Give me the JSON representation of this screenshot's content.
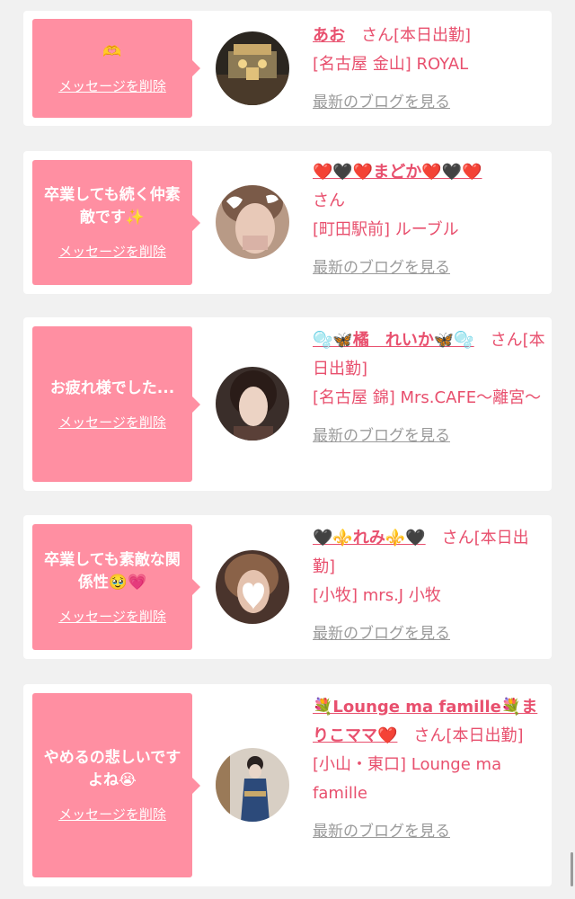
{
  "messages": [
    {
      "bubble_text": "🫶",
      "delete_label": "メッセージを削除",
      "name": "あお",
      "san_suffix": "さん[本日出勤]",
      "shop": "[名古屋 金山] ROYAL",
      "blog_label": "最新のブログを見る"
    },
    {
      "bubble_text": "卒業しても続く仲素敵です✨",
      "delete_label": "メッセージを削除",
      "name": "❤️🖤❤️まどか❤️🖤❤️",
      "san_suffix": "さん",
      "shop": "[町田駅前] ルーブル",
      "blog_label": "最新のブログを見る"
    },
    {
      "bubble_text": "お疲れ様でした...",
      "delete_label": "メッセージを削除",
      "name": "🫧🦋橘　れいか🦋🫧",
      "san_suffix": "さん[本日出勤]",
      "shop": "[名古屋 錦] Mrs.CAFE〜離宮〜",
      "blog_label": "最新のブログを見る"
    },
    {
      "bubble_text": "卒業しても素敵な関係性🥹💗",
      "delete_label": "メッセージを削除",
      "name": "🖤⚜️れみ⚜️🖤",
      "san_suffix": "さん[本日出勤]",
      "shop": "[小牧] mrs.J 小牧",
      "blog_label": "最新のブログを見る"
    },
    {
      "bubble_text": "やめるの悲しいですよね😭",
      "delete_label": "メッセージを削除",
      "name": "💐Lounge ma famille💐まりこママ❤️",
      "san_suffix": "さん[本日出勤]",
      "shop": "[小山・東口] Lounge ma famille",
      "blog_label": "最新のブログを見る"
    }
  ],
  "colors": {
    "bubble": "#ff8fa2",
    "accent": "#e8506e",
    "muted_link": "#9a9a9a",
    "background": "#f1f1f1"
  }
}
